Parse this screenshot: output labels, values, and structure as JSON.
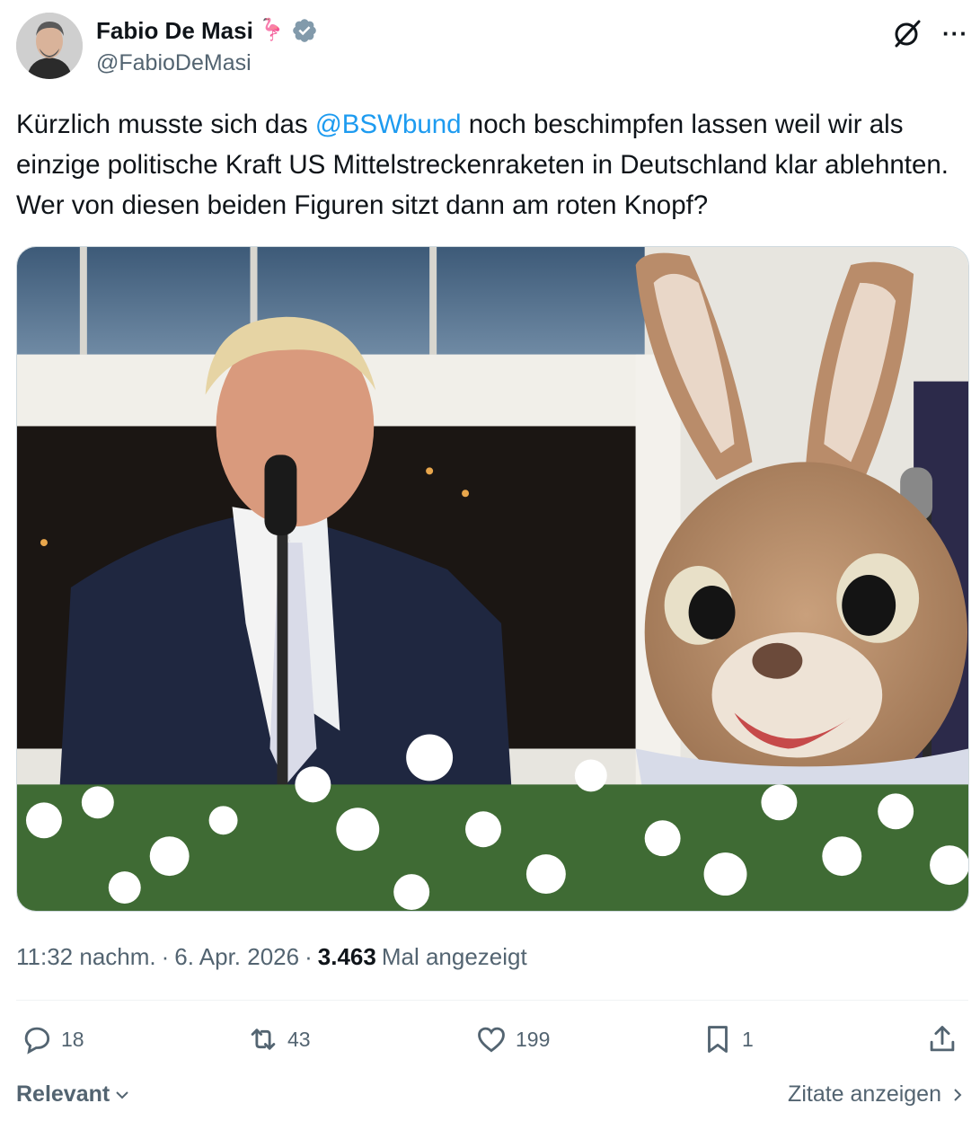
{
  "author": {
    "display_name": "Fabio De Masi",
    "emoji": "🦩",
    "handle": "@FabioDeMasi",
    "verified": true,
    "avatar_icon": "avatar-photo"
  },
  "header_icons": [
    "grok-icon",
    "more-icon"
  ],
  "tweet": {
    "text_before_mention": "Kürzlich musste sich das ",
    "mention": "@BSWbund",
    "text_after_mention": " noch beschimpfen lassen weil wir als einzige politische Kraft US Mittelstreckenraketen in Deutschland klar ablehnten. Wer von diesen beiden Figuren sitzt dann am roten Knopf?"
  },
  "meta": {
    "time": "11:32 nachm.",
    "sep1": "·",
    "date": "6. Apr. 2026",
    "sep2": "·",
    "views_count": "3.463",
    "views_label": "Mal angezeigt"
  },
  "actions": {
    "replies": "18",
    "reposts": "43",
    "likes": "199",
    "bookmarks": "1"
  },
  "footer": {
    "sort_label": "Relevant",
    "quotes_label": "Zitate anzeigen"
  },
  "colors": {
    "accent": "#1d9bf0",
    "secondary_text": "#536471",
    "primary_text": "#0f1419"
  }
}
